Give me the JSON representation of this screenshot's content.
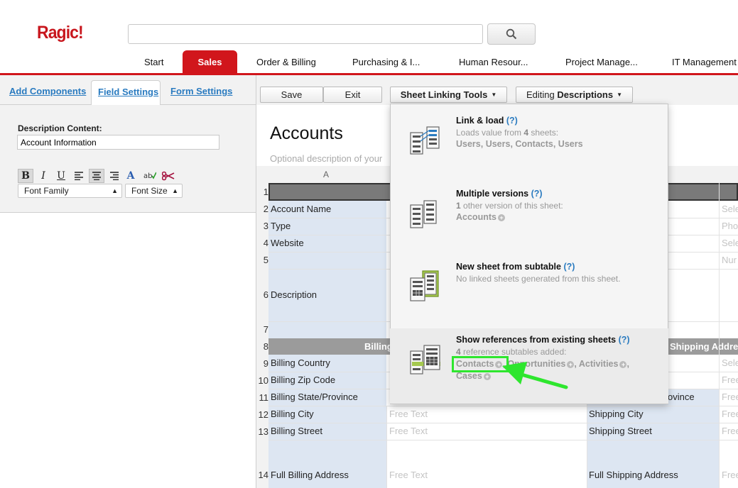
{
  "app": {
    "logo": "Ragic!"
  },
  "search": {
    "value": "",
    "placeholder": ""
  },
  "nav_tabs": [
    {
      "label": "Start",
      "active": false
    },
    {
      "label": "Sales",
      "active": true
    },
    {
      "label": "Order & Billing",
      "active": false
    },
    {
      "label": "Purchasing & I...",
      "active": false
    },
    {
      "label": "Human Resour...",
      "active": false
    },
    {
      "label": "Project Manage...",
      "active": false
    },
    {
      "label": "IT Management",
      "active": false
    }
  ],
  "left_panel": {
    "tabs": [
      {
        "label": "Add Components"
      },
      {
        "label": "Field Settings",
        "active": true
      },
      {
        "label": "Form Settings"
      }
    ],
    "description_label": "Description Content:",
    "description_value": "Account Information",
    "font_family": "Font Family",
    "font_size": "Font Size"
  },
  "toolbar": {
    "save": "Save",
    "exit": "Exit",
    "sheet_linking_tools": "Sheet Linking Tools",
    "editing_prefix": "Editing ",
    "editing_bold": "Descriptions"
  },
  "sheet": {
    "title": "Accounts",
    "description_placeholder": "Optional description of your",
    "column_a": "A",
    "rows": [
      {
        "num": "1"
      },
      {
        "num": "2",
        "label": "Account Name",
        "value2": "Sele"
      },
      {
        "num": "3",
        "label": "Type",
        "value2": "Pho"
      },
      {
        "num": "4",
        "label": "Website",
        "value2": "Sele"
      },
      {
        "num": "5",
        "label": "",
        "value2": "Nur"
      },
      {
        "num": "6",
        "label": "Description"
      },
      {
        "num": "7",
        "label": ""
      },
      {
        "num": "8",
        "section_left": "Billing",
        "section_right": "Shipping Addre"
      },
      {
        "num": "9",
        "label": "Billing Country",
        "value2": "Sele"
      },
      {
        "num": "10",
        "label": "Billing Zip Code",
        "value2": "Free"
      },
      {
        "num": "11",
        "label": "Billing State/Province",
        "label2": "ovince",
        "value2": "Free"
      },
      {
        "num": "12",
        "label": "Billing City",
        "value": "Free Text",
        "label2": "Shipping City",
        "value2": "Free"
      },
      {
        "num": "13",
        "label": "Billing Street",
        "value": "Free Text",
        "label2": "Shipping Street",
        "value2": "Free"
      },
      {
        "num": "14",
        "label": "Full Billing Address",
        "value": "Free Text",
        "label2": "Full Shipping Address",
        "value2": "Free"
      }
    ]
  },
  "dropdown": {
    "items": [
      {
        "title": "Link & load",
        "help": "(?)",
        "sub_prefix": "Loads value from ",
        "sub_count": "4",
        "sub_suffix": " sheets:",
        "links": "Users, Users, Contacts, Users"
      },
      {
        "title": "Multiple versions",
        "help": "(?)",
        "sub_prefix": "",
        "sub_count": "1",
        "sub_suffix": " other version of this sheet:",
        "links": "Accounts"
      },
      {
        "title": "New sheet from subtable",
        "help": "(?)",
        "sub": "No linked sheets generated from this sheet."
      },
      {
        "title": "Show references from existing sheets",
        "help": "(?)",
        "sub_count": "4",
        "sub_suffix": " reference subtables added:",
        "links": [
          "Contacts",
          "Opportunities",
          "Activities",
          "Cases"
        ]
      }
    ]
  },
  "colors": {
    "brand_red": "#d1161c",
    "label_bg": "#dde6f2",
    "highlight_green": "#2ee62e",
    "link_blue": "#2a7bc0"
  }
}
